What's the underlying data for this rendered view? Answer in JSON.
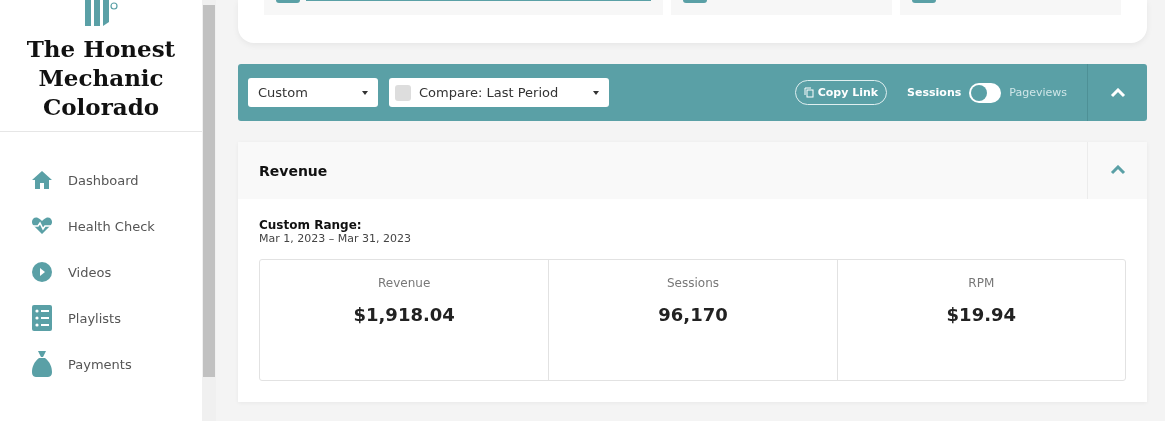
{
  "sidebar": {
    "brand": "The Honest Mechanic Colorado",
    "items": [
      {
        "label": "Dashboard"
      },
      {
        "label": "Health Check"
      },
      {
        "label": "Videos"
      },
      {
        "label": "Playlists"
      },
      {
        "label": "Payments"
      }
    ]
  },
  "toolbar": {
    "range": "Custom",
    "compare": {
      "label": "Compare: Last Period",
      "checked": false
    },
    "copy_link": "Copy Link",
    "metrics": [
      {
        "label": "Sessions",
        "selected": true
      },
      {
        "label": "Pageviews",
        "selected": false
      }
    ],
    "toggle_on": false,
    "expanded": true
  },
  "panel": {
    "title": "Revenue",
    "expanded": true,
    "range_label": "Custom Range:",
    "range": "Mar 1, 2023 – Mar 31, 2023",
    "stats": [
      {
        "label": "Revenue",
        "value": "$1,918.04"
      },
      {
        "label": "Sessions",
        "value": "96,170"
      },
      {
        "label": "RPM",
        "value": "$19.94"
      }
    ]
  }
}
